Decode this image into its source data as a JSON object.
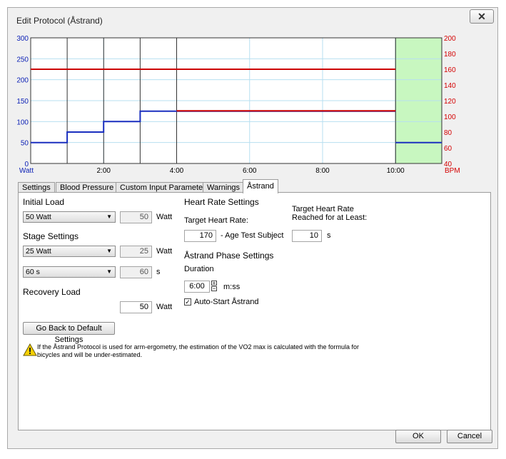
{
  "window": {
    "title": "Edit Protocol (Åstrand)",
    "close_glyph": "✕"
  },
  "chart_data": {
    "type": "line",
    "x_tick_labels": [
      "2:00",
      "4:00",
      "6:00",
      "8:00",
      "10:00"
    ],
    "x_ticks_seconds": [
      120,
      240,
      360,
      480,
      600
    ],
    "x_range_seconds": [
      0,
      676
    ],
    "y_left": {
      "label": "Watt",
      "ticks": [
        0,
        50,
        100,
        150,
        200,
        250,
        300
      ],
      "range": [
        0,
        300
      ],
      "color": "#0a1fb5"
    },
    "y_right": {
      "label": "BPM",
      "ticks": [
        40,
        60,
        80,
        100,
        120,
        140,
        160,
        180,
        200
      ],
      "range": [
        40,
        200
      ],
      "color": "#d40000"
    },
    "stage_boundaries_seconds": [
      60,
      120,
      180
    ],
    "recovery_start_seconds": 600,
    "series": [
      {
        "axis": "left",
        "color": "#1a2fbf",
        "points": [
          [
            0,
            50
          ],
          [
            60,
            50
          ],
          [
            60,
            75
          ],
          [
            120,
            75
          ],
          [
            120,
            100
          ],
          [
            180,
            100
          ],
          [
            180,
            125
          ],
          [
            600,
            125
          ]
        ]
      },
      {
        "axis": "left",
        "color": "#1a2fbf",
        "points": [
          [
            600,
            50
          ],
          [
            676,
            50
          ]
        ]
      },
      {
        "axis": "right",
        "color": "#cc0000",
        "points": [
          [
            0,
            160
          ],
          [
            600,
            160
          ]
        ]
      },
      {
        "axis": "right",
        "color": "#cc0000",
        "points": [
          [
            240,
            107
          ],
          [
            600,
            107
          ]
        ]
      }
    ]
  },
  "tabs": [
    "Settings",
    "Blood Pressure",
    "Custom Input Parameters",
    "Warnings",
    "Åstrand"
  ],
  "left": {
    "initial_load_label": "Initial Load",
    "initial_load_select": "50 Watt",
    "initial_load_value": "50",
    "initial_load_unit": "Watt",
    "stage_settings_label": "Stage Settings",
    "stage_load_select": "25 Watt",
    "stage_load_value": "25",
    "stage_load_unit": "Watt",
    "stage_time_select": "60 s",
    "stage_time_value": "60",
    "stage_time_unit": "s",
    "recovery_label": "Recovery Load",
    "recovery_value": "50",
    "recovery_unit": "Watt",
    "default_button": "Go Back to Default Settings"
  },
  "right": {
    "hr_heading": "Heart Rate Settings",
    "target_hr_label": "Target Heart Rate:",
    "target_hr_reached_label_1": "Target Heart Rate",
    "target_hr_reached_label_2": "Reached for at Least:",
    "target_hr_value": "170",
    "age_label": "- Age Test Subject",
    "reached_value": "10",
    "reached_unit": "s",
    "phase_heading": "Åstrand Phase Settings",
    "duration_label": "Duration",
    "duration_value": "6:00",
    "duration_unit": "m:ss",
    "autostart_label": "Auto-Start Åstrand",
    "autostart_checked": true
  },
  "warning": {
    "text": "If the Åstrand Protocol is used for arm-ergometry, the estimation of the VO2 max is calculated with the formula for bicycles and will be under-estimated."
  },
  "footer": {
    "ok": "OK",
    "cancel": "Cancel"
  }
}
